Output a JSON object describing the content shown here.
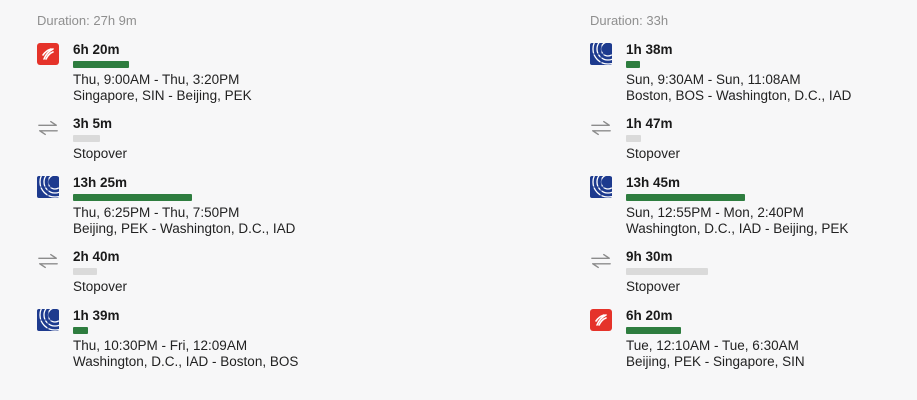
{
  "itineraries": [
    {
      "duration_label": "Duration: 27h 9m",
      "segments": [
        {
          "kind": "flight",
          "airline_icon": "air-china-logo-icon",
          "duration": "6h 20m",
          "bar_fraction": 0.47,
          "times": "Thu, 9:00AM - Thu, 3:20PM",
          "route": "Singapore, SIN - Beijing, PEK"
        },
        {
          "kind": "stopover",
          "duration": "3h 5m",
          "bar_fraction": 0.23,
          "label": "Stopover"
        },
        {
          "kind": "flight",
          "airline_icon": "united-logo-icon",
          "duration": "13h 25m",
          "bar_fraction": 1.0,
          "times": "Thu, 6:25PM - Thu, 7:50PM",
          "route": "Beijing, PEK - Washington, D.C., IAD"
        },
        {
          "kind": "stopover",
          "duration": "2h 40m",
          "bar_fraction": 0.2,
          "label": "Stopover"
        },
        {
          "kind": "flight",
          "airline_icon": "united-logo-icon",
          "duration": "1h 39m",
          "bar_fraction": 0.13,
          "times": "Thu, 10:30PM - Fri, 12:09AM",
          "route": "Washington, D.C., IAD - Boston, BOS"
        }
      ]
    },
    {
      "duration_label": "Duration: 33h",
      "segments": [
        {
          "kind": "flight",
          "airline_icon": "united-logo-icon",
          "duration": "1h 38m",
          "bar_fraction": 0.12,
          "times": "Sun, 9:30AM - Sun, 11:08AM",
          "route": "Boston, BOS - Washington, D.C., IAD"
        },
        {
          "kind": "stopover",
          "duration": "1h 47m",
          "bar_fraction": 0.13,
          "label": "Stopover"
        },
        {
          "kind": "flight",
          "airline_icon": "united-logo-icon",
          "duration": "13h 45m",
          "bar_fraction": 1.0,
          "times": "Sun, 12:55PM - Mon, 2:40PM",
          "route": "Washington, D.C., IAD - Beijing, PEK"
        },
        {
          "kind": "stopover",
          "duration": "9h 30m",
          "bar_fraction": 0.69,
          "label": "Stopover"
        },
        {
          "kind": "flight",
          "airline_icon": "air-china-logo-icon",
          "duration": "6h 20m",
          "bar_fraction": 0.46,
          "times": "Tue, 12:10AM - Tue, 6:30AM",
          "route": "Beijing, PEK - Singapore, SIN"
        }
      ]
    }
  ],
  "colors": {
    "flight_bar": "#2e7d3f",
    "stop_bar": "#dadada",
    "duration_text": "#8f8f8f",
    "air_china": "#e5332a",
    "united": "#1d3a8e"
  }
}
